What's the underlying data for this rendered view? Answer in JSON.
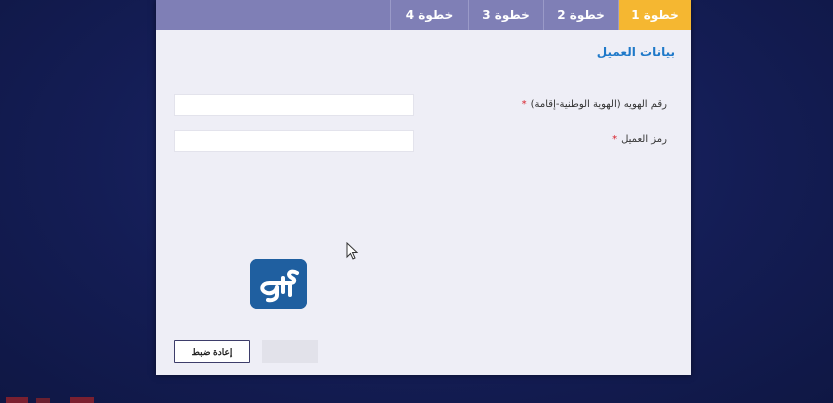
{
  "steps": [
    {
      "label": "خطوة 1",
      "active": true
    },
    {
      "label": "خطوة 2",
      "active": false
    },
    {
      "label": "خطوة 3",
      "active": false
    },
    {
      "label": "خطوة 4",
      "active": false
    }
  ],
  "form": {
    "section_title": "بيانات العميل",
    "id_label": "رقم الهويه (الهوية الوطنية-إقامة)",
    "id_required": "*",
    "id_value": "",
    "code_label": "رمز العميل",
    "code_required": "*",
    "code_value": ""
  },
  "buttons": {
    "reset_label": "إعادة ضبط",
    "submit_label": ""
  },
  "colors": {
    "active_step": "#f5b731",
    "step_bar": "#7f7fb6",
    "section_title": "#1f79c9",
    "required": "#d8202a",
    "background": "#141d55"
  },
  "logo": {
    "name": "almrj3-logo"
  }
}
